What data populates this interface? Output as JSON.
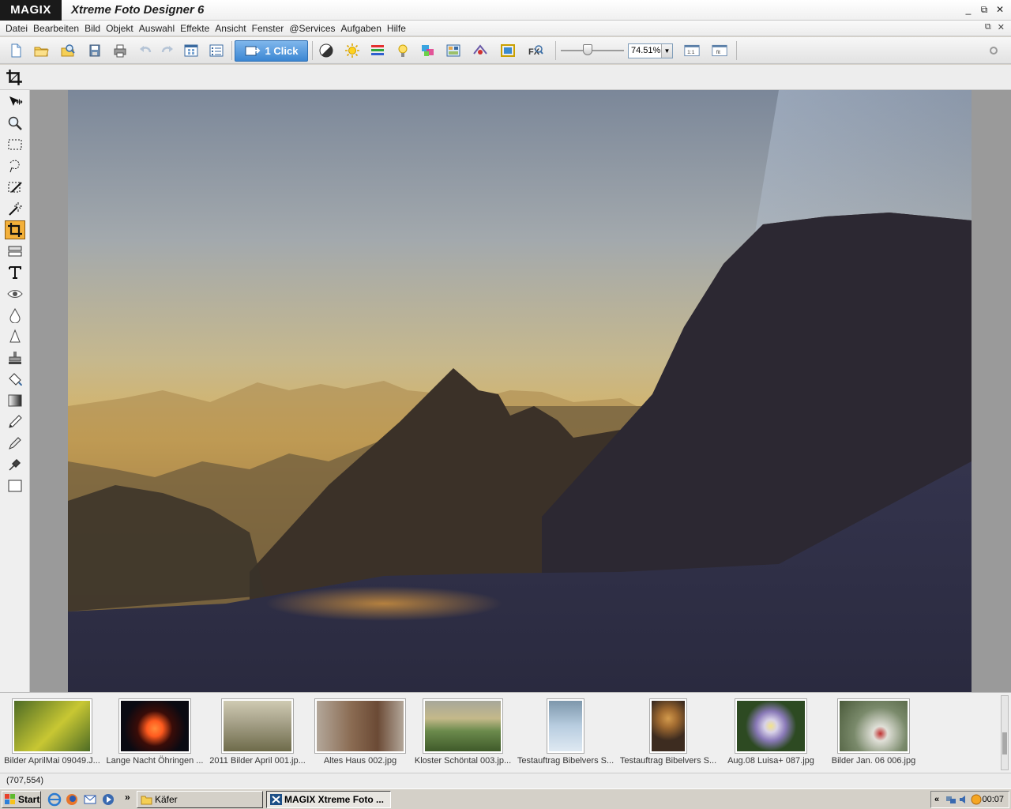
{
  "titlebar": {
    "brand": "MAGIX",
    "title": "Xtreme Foto Designer 6",
    "buttons": [
      "_",
      "⧉",
      "✕"
    ]
  },
  "menu": [
    "Datei",
    "Bearbeiten",
    "Bild",
    "Objekt",
    "Auswahl",
    "Effekte",
    "Ansicht",
    "Fenster",
    "@Services",
    "Aufgaben",
    "Hilfe"
  ],
  "mdi_buttons": [
    "⧉",
    "✕"
  ],
  "toolbar": {
    "one_click_label": "1 Click",
    "zoom_value": "74.51%",
    "zoom_arrow": "▼",
    "fit_1_1": "1:1",
    "fit_label": "fit"
  },
  "filmstrip": [
    {
      "caption": "Bilder AprilMai 09049.J...",
      "colors": [
        "#c8c733",
        "#4d6b25"
      ]
    },
    {
      "caption": "Lange Nacht Öhringen ...",
      "colors": [
        "#0a0a12",
        "#ff5a1e"
      ]
    },
    {
      "caption": "2011 Bilder April 001.jp...",
      "colors": [
        "#a9a48c",
        "#6e6b4a"
      ]
    },
    {
      "caption": "Altes Haus 002.jpg",
      "colors": [
        "#8a6b52",
        "#b3a79a"
      ]
    },
    {
      "caption": "Kloster Schöntal 003.jp...",
      "colors": [
        "#6b8a4c",
        "#a7a79a"
      ]
    },
    {
      "caption": "Testauftrag Bibelvers S...",
      "colors": [
        "#b8cde0",
        "#7d97ab"
      ]
    },
    {
      "caption": "Testauftrag Bibelvers S...",
      "colors": [
        "#3d2c20",
        "#d29a4c"
      ]
    },
    {
      "caption": "Aug.08 Luisa+ 087.jpg",
      "colors": [
        "#2d4a22",
        "#d8d2e8"
      ]
    },
    {
      "caption": "Bilder Jan. 06 006.jpg",
      "colors": [
        "#7a8a6b",
        "#e0e0d8"
      ]
    }
  ],
  "status": {
    "coords": "(707,554)"
  },
  "taskbar": {
    "start_label": "Start",
    "chevron": "»",
    "folder_task": "Käfer",
    "app_task": "MAGIX Xtreme Foto ...",
    "tray_chevron": "«",
    "clock": "00:07"
  },
  "colors": {
    "accent": "#3b86d3",
    "active_tool": "#f3b03a"
  }
}
